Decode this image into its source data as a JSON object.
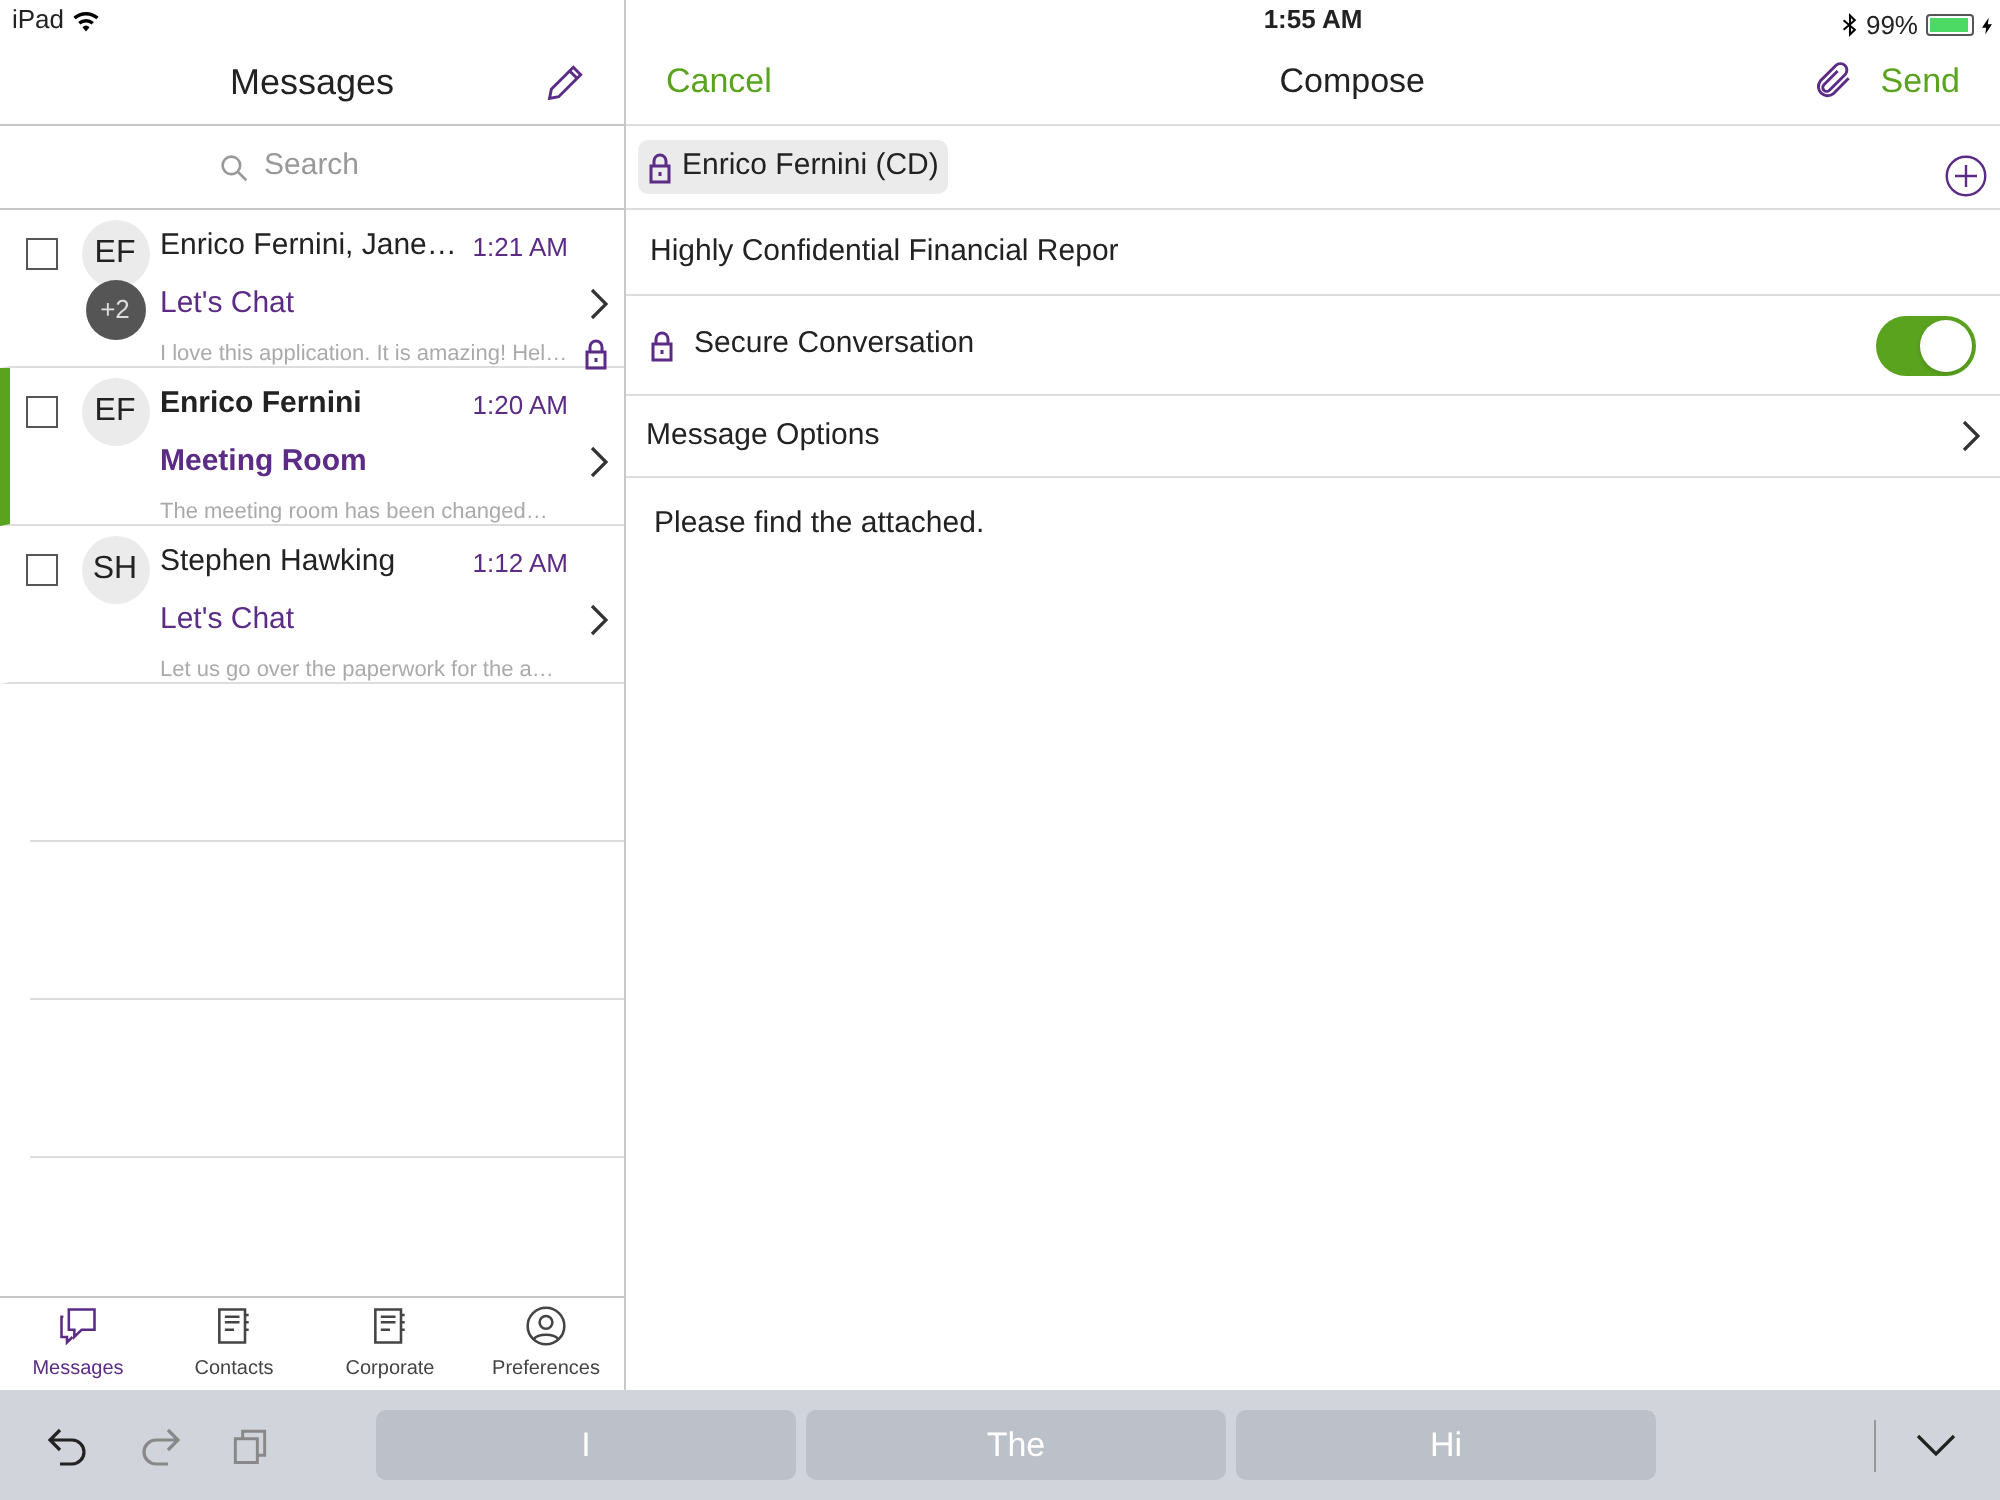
{
  "status_bar": {
    "device": "iPad",
    "time": "1:55 AM",
    "battery": "99%"
  },
  "messages_pane": {
    "title": "Messages",
    "search": {
      "placeholder": "Search"
    },
    "conversations": [
      {
        "initials": "EF",
        "extra": "+2",
        "sender": "Enrico Fernini, Jane…",
        "time": "1:21 AM",
        "subject": "Let's Chat",
        "preview": "I love this application. It is amazing! Hel…",
        "secure": true,
        "selected": false,
        "checked": false
      },
      {
        "initials": "EF",
        "sender": "Enrico Fernini",
        "time": "1:20 AM",
        "subject": "Meeting Room",
        "preview": "The meeting room has been changed…",
        "secure": false,
        "selected": true,
        "checked": false
      },
      {
        "initials": "SH",
        "sender": "Stephen Hawking",
        "time": "1:12 AM",
        "subject": "Let's Chat",
        "preview": "Let us go over the paperwork for the a…",
        "secure": false,
        "selected": false,
        "checked": false
      }
    ],
    "tabs": [
      {
        "label": "Messages",
        "kind": "chat",
        "selected": true
      },
      {
        "label": "Contacts",
        "kind": "book",
        "selected": false
      },
      {
        "label": "Corporate",
        "kind": "book",
        "selected": false
      },
      {
        "label": "Preferences",
        "kind": "person",
        "selected": false
      }
    ]
  },
  "compose": {
    "cancel": "Cancel",
    "title": "Compose",
    "send": "Send",
    "recipients": [
      {
        "name": "Enrico Fernini (CD)",
        "secure": true
      }
    ],
    "subject": "Highly Confidential Financial Repor",
    "secure_conversation": {
      "label": "Secure Conversation",
      "on": true
    },
    "message_options": "Message Options",
    "body": "Please find the attached."
  },
  "keyboard_bar": {
    "undo_disabled": false,
    "redo_disabled": true,
    "suggestions": [
      "I",
      "The",
      "Hi"
    ]
  }
}
